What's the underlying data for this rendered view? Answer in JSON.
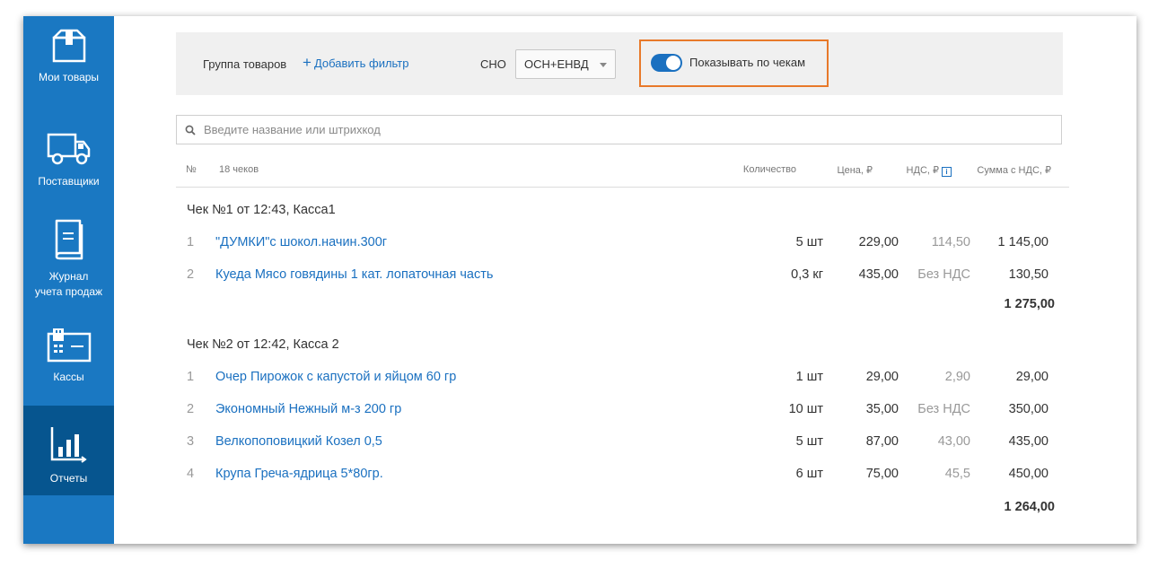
{
  "sidebar": {
    "items": [
      {
        "label": "Мои товары",
        "icon": "box-icon"
      },
      {
        "label": "Поставщики",
        "icon": "truck-icon"
      },
      {
        "label": "Журнал\nучета продаж",
        "icon": "book-icon"
      },
      {
        "label": "Кассы",
        "icon": "register-icon"
      },
      {
        "label": "Отчеты",
        "icon": "bar-chart-icon",
        "active": true
      }
    ]
  },
  "filters": {
    "group_label": "Группа товаров",
    "add_filter_plus": "+",
    "add_filter_label": "Добавить фильтр",
    "sno_label": "СНО",
    "sno_value": "ОСН+ЕНВД",
    "toggle_label": "Показывать по чекам",
    "toggle_on": true
  },
  "search": {
    "placeholder": "Введите название или штрихкод"
  },
  "table": {
    "headers": {
      "num": "№",
      "checks": "18 чеков",
      "qty": "Количество",
      "price": "Цена, ₽",
      "vat": "НДС, ₽",
      "vat_info": "i",
      "sum": "Сумма с НДС, ₽"
    },
    "checks": [
      {
        "title": "Чек №1 от 12:43, Касса1",
        "rows": [
          {
            "num": "1",
            "name": "\"ДУМКИ\"с шокол.начин.300г",
            "qty": "5 шт",
            "price": "229,00",
            "vat": "114,50",
            "sum": "1 145,00"
          },
          {
            "num": "2",
            "name": "Куеда Мясо говядины 1 кат. лопаточная часть",
            "qty": "0,3 кг",
            "price": "435,00",
            "vat": "Без НДС",
            "sum": "130,50"
          }
        ],
        "total": "1 275,00"
      },
      {
        "title": "Чек №2 от 12:42, Касса 2",
        "rows": [
          {
            "num": "1",
            "name": "Очер Пирожок с капустой и яйцом 60 гр",
            "qty": "1 шт",
            "price": "29,00",
            "vat": "2,90",
            "sum": "29,00"
          },
          {
            "num": "2",
            "name": "Экономный Нежный м-з 200 гр",
            "qty": "10 шт",
            "price": "35,00",
            "vat": "Без НДС",
            "sum": "350,00"
          },
          {
            "num": "3",
            "name": "Велкопоповицкий Козел 0,5",
            "qty": "5 шт",
            "price": "87,00",
            "vat": "43,00",
            "sum": "435,00"
          },
          {
            "num": "4",
            "name": "Крупа Греча-ядрица 5*80гр.",
            "qty": "6 шт",
            "price": "75,00",
            "vat": "45,5",
            "sum": "450,00"
          }
        ],
        "total": "1 264,00"
      }
    ]
  },
  "colors": {
    "sidebar": "#1a78c2",
    "sidebar_active": "#06558f",
    "link": "#1a70c0",
    "highlight_border": "#e8792a"
  }
}
